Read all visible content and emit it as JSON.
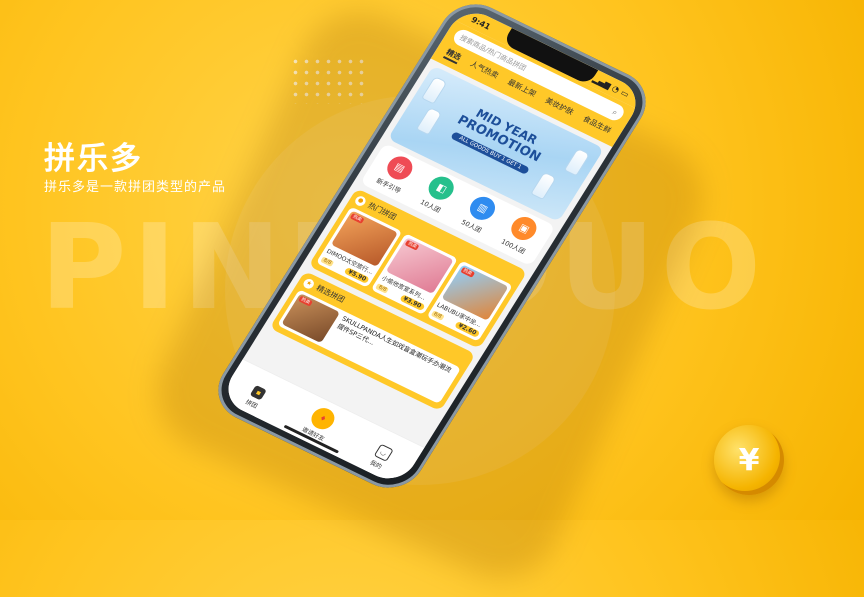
{
  "brand": {
    "title": "拼乐多",
    "tagline": "拼乐多是一款拼团类型的产品",
    "watermark": "PINLEDUO"
  },
  "status_bar": {
    "time": "9:41"
  },
  "search": {
    "placeholder": "搜索商品/热门商品拼团",
    "icon": "search-icon"
  },
  "tabs": [
    {
      "label": "精选",
      "active": true
    },
    {
      "label": "人气热卖"
    },
    {
      "label": "最新上架"
    },
    {
      "label": "美妆护肤"
    },
    {
      "label": "食品生鲜"
    }
  ],
  "banner": {
    "line1": "MID YEAR",
    "line2": "PROMOTION",
    "line3": "ALL GOODS BUY 1 GET 1"
  },
  "categories": [
    {
      "label": "新手引导",
      "color": "#ef4b55",
      "icon": "guide-icon"
    },
    {
      "label": "10人团",
      "color": "#26c08c",
      "icon": "bag-icon"
    },
    {
      "label": "50人团",
      "color": "#2f8cf0",
      "icon": "basket-icon"
    },
    {
      "label": "100人团",
      "color": "#ff8a2a",
      "icon": "cart-icon"
    }
  ],
  "hot_section": {
    "title": "热门拼团",
    "items": [
      {
        "name": "DIMOO太空旅行...",
        "badge": "8/8",
        "price": "¥5.90",
        "tag": "热卖"
      },
      {
        "name": "小偷他宫室系列...",
        "badge": "8/8",
        "price": "¥3.90",
        "tag": "热卖"
      },
      {
        "name": "LABUBU家中坐...",
        "badge": "8/8",
        "price": "¥2.60",
        "tag": "热卖"
      }
    ]
  },
  "featured_section": {
    "title": "精选拼团",
    "item": {
      "text": "SKULLPANDA人生如戏盲盒潮玩手办潮流摆件SP三代...",
      "tag": "热卖"
    }
  },
  "navbar": [
    {
      "label": "拼团",
      "icon": "group-icon"
    },
    {
      "label": "邀请好友",
      "icon": "gift-icon"
    },
    {
      "label": "我的",
      "icon": "profile-icon"
    }
  ],
  "coin": {
    "symbol": "¥"
  },
  "colors": {
    "accent": "#ffc828",
    "background": "#ffc41f"
  }
}
